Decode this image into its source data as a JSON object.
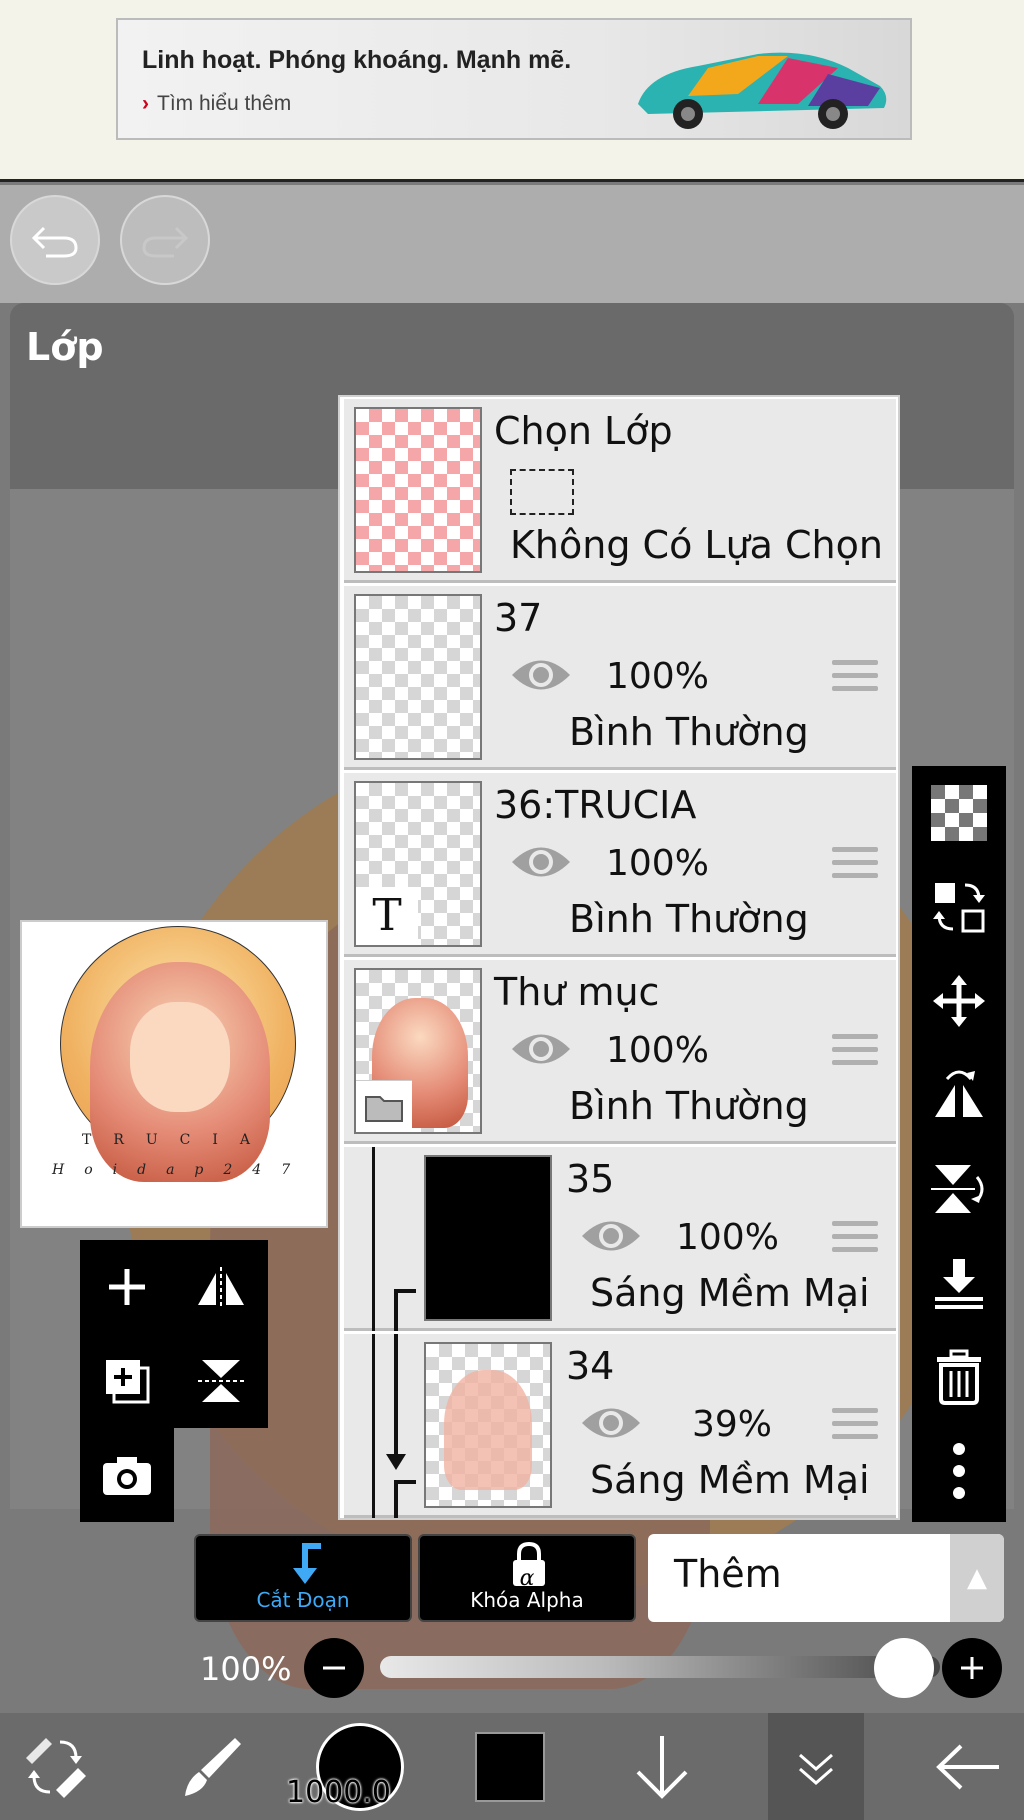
{
  "ad": {
    "title": "Linh hoạt. Phóng khoáng. Mạnh mẽ.",
    "link": "Tìm hiểu thêm",
    "link_chevron": "›"
  },
  "toolbar": {
    "undo_icon": "undo-icon",
    "redo_icon": "redo-icon"
  },
  "panel": {
    "title": "Lớp"
  },
  "preview": {
    "line1": "TRUCIA",
    "line2": "Hoidap247"
  },
  "selection_layer": {
    "name": "Chọn Lớp",
    "status": "Không Có Lựa Chọn"
  },
  "layers": [
    {
      "name": "37",
      "opacity": "100%",
      "blend": "Bình Thường"
    },
    {
      "name": "36:TRUCIA",
      "opacity": "100%",
      "blend": "Bình Thường",
      "text_icon": "T"
    },
    {
      "name": "Thư mục",
      "opacity": "100%",
      "blend": "Bình Thường"
    },
    {
      "name": "35",
      "opacity": "100%",
      "blend": "Sáng Mềm Mại"
    },
    {
      "name": "34",
      "opacity": "39%",
      "blend": "Sáng Mềm Mại"
    }
  ],
  "controls": {
    "clipping_label": "Cắt Đoạn",
    "alpha_lock_label": "Khóa Alpha",
    "alpha_symbol": "α",
    "blend_mode": "Thêm",
    "opacity_label": "100%",
    "opacity_value": 1.0
  },
  "bottom_nav": {
    "brush_size": "1000.0"
  },
  "colors": {
    "accent_blue": "#3fa9f5",
    "primary_color": "#000000"
  }
}
